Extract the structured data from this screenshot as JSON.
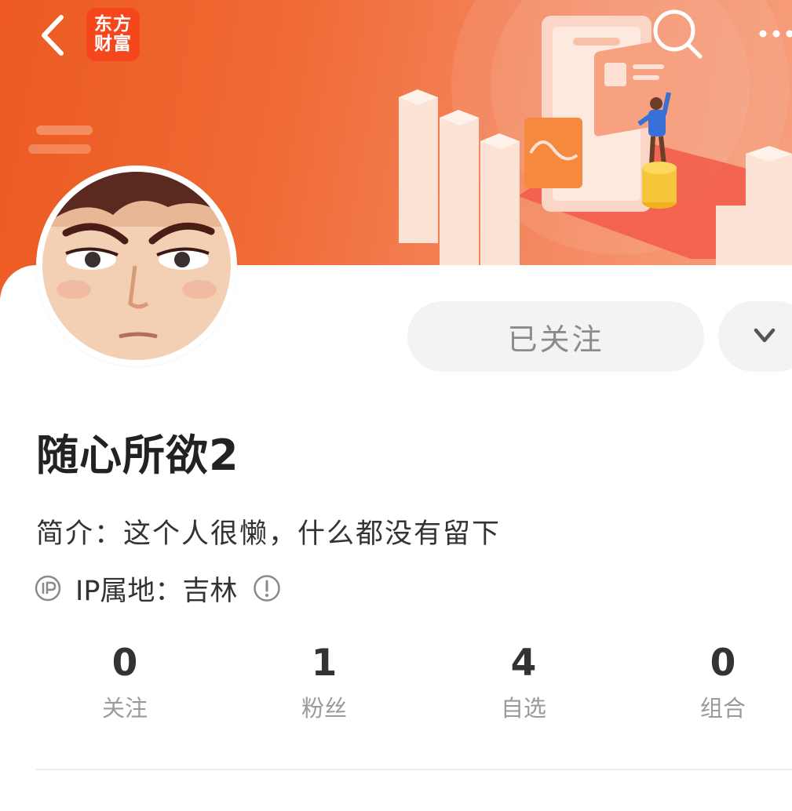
{
  "header": {
    "logo_line1": "东方",
    "logo_line2": "财富",
    "back_icon": "back-arrow-icon",
    "search_icon": "search-icon",
    "more_icon": "more-dots-icon"
  },
  "profile": {
    "username": "随心所欲2",
    "bio": "简介：这个人很懒，什么都没有留下",
    "ip_location": "IP属地：吉林",
    "follow_button_label": "已关注"
  },
  "stats": [
    {
      "value": "0",
      "label": "关注"
    },
    {
      "value": "1",
      "label": "粉丝"
    },
    {
      "value": "4",
      "label": "自选"
    },
    {
      "value": "0",
      "label": "组合"
    }
  ],
  "colors": {
    "brand": "#f6461c",
    "banner_start": "#ec5a22",
    "banner_end": "#f7a07e",
    "button_bg": "#f3f3f3"
  }
}
